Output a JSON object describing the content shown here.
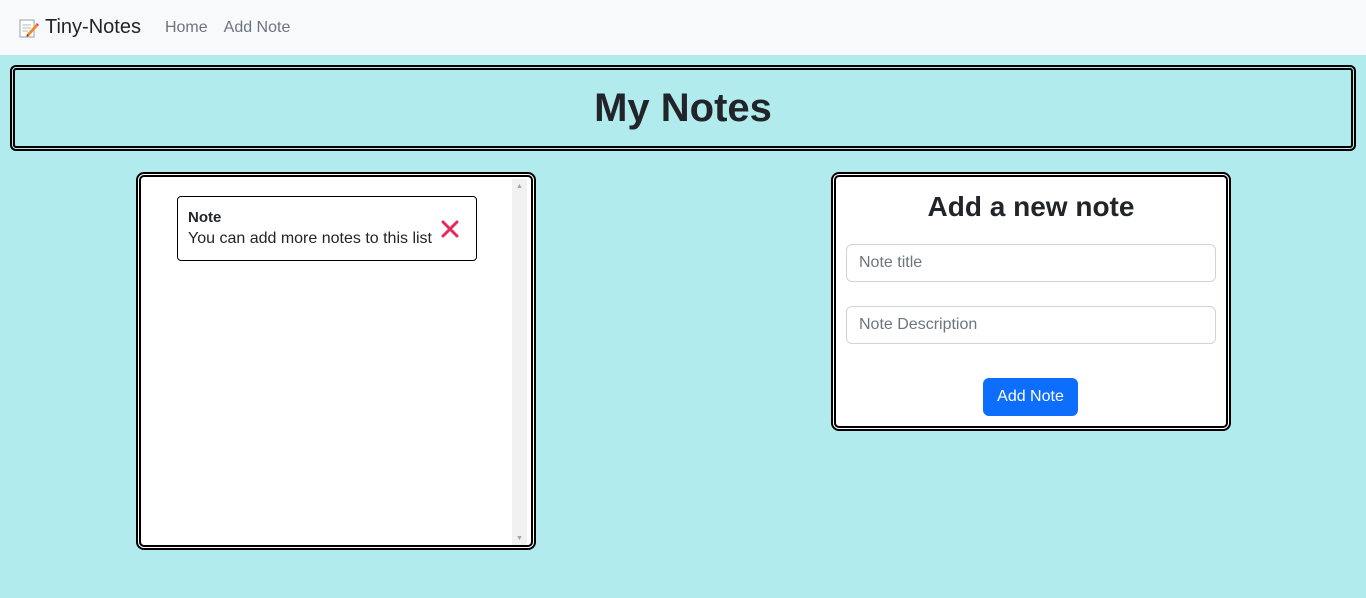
{
  "navbar": {
    "brand_icon": "memo-icon",
    "brand": "Tiny-Notes",
    "links": [
      "Home",
      "Add Note"
    ]
  },
  "header": {
    "title": "My Notes"
  },
  "notes": [
    {
      "title": "Note",
      "description": "You can add more notes to this list",
      "delete_icon": "close-icon"
    }
  ],
  "form": {
    "title": "Add a new note",
    "title_placeholder": "Note title",
    "description_placeholder": "Note Description",
    "submit_label": "Add Note"
  },
  "colors": {
    "background": "#b2ebed",
    "navbar": "#f8f9fa",
    "primary_button": "#0d6efd",
    "delete_icon": "#e8275d"
  }
}
